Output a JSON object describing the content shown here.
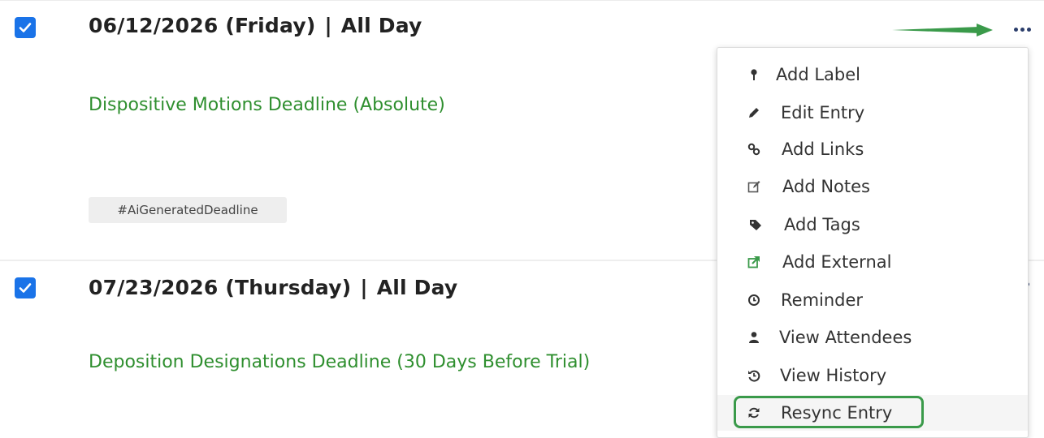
{
  "entries": [
    {
      "checked": true,
      "date": "06/12/2026 (Friday)",
      "separator": "|",
      "time": "All Day",
      "title": "Dispositive Motions Deadline (Absolute)",
      "tag": "#AiGeneratedDeadline"
    },
    {
      "checked": true,
      "date": "07/23/2026 (Thursday)",
      "separator": "|",
      "time": "All Day",
      "title": "Deposition Designations Deadline (30 Days Before Trial)"
    }
  ],
  "colors": {
    "checkbox": "#1a73e8",
    "title_link": "#2f8f2f",
    "annotation": "#3a9a4a",
    "more_dots": "#2b3e6b"
  },
  "context_menu": {
    "items": [
      {
        "label": "Add Label",
        "icon": "pin-icon"
      },
      {
        "label": "Edit Entry",
        "icon": "pencil-icon"
      },
      {
        "label": "Add Links",
        "icon": "link-icon"
      },
      {
        "label": "Add Notes",
        "icon": "note-edit-icon"
      },
      {
        "label": "Add Tags",
        "icon": "tags-icon"
      },
      {
        "label": "Add External",
        "icon": "external-link-icon"
      },
      {
        "label": "Reminder",
        "icon": "clock-icon"
      },
      {
        "label": "View Attendees",
        "icon": "user-icon"
      },
      {
        "label": "View History",
        "icon": "history-icon"
      },
      {
        "label": "Resync Entry",
        "icon": "refresh-icon",
        "highlighted": true
      }
    ]
  }
}
